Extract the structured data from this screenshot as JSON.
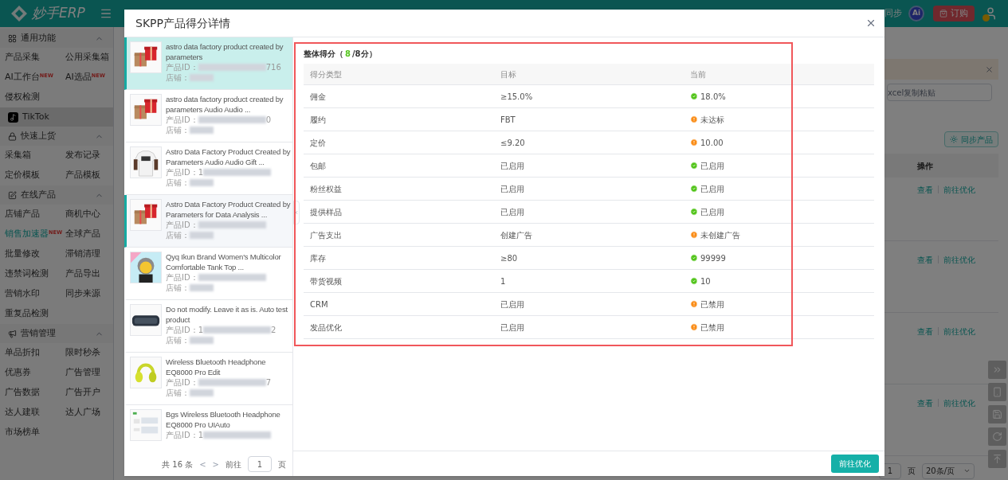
{
  "header": {
    "logo": "妙手ERP",
    "sync": "同步",
    "ai": "Ai",
    "buy": "订购"
  },
  "sidebar": {
    "sections": [
      {
        "kind": "group",
        "title": "通用功能",
        "expanded": true,
        "items": [
          {
            "label": "产品采集",
            "selected": false
          },
          {
            "label": "公用采集箱",
            "selected": false
          },
          {
            "label": "AI工作台",
            "badge": "NEW",
            "selected": false
          },
          {
            "label": "AI选品",
            "badge": "NEW",
            "selected": false
          },
          {
            "label": "侵权检测",
            "selected": false
          }
        ]
      },
      {
        "kind": "platform",
        "title": "TikTok",
        "selected": true
      },
      {
        "kind": "group",
        "title": "快速上货",
        "expanded": true,
        "items": [
          {
            "label": "采集箱",
            "selected": false
          },
          {
            "label": "发布记录",
            "selected": false
          },
          {
            "label": "定价模板",
            "selected": false
          },
          {
            "label": "产品模板",
            "selected": false
          }
        ]
      },
      {
        "kind": "group",
        "title": "在线产品",
        "expanded": true,
        "items": [
          {
            "label": "店铺产品",
            "selected": false
          },
          {
            "label": "商机中心",
            "selected": false
          },
          {
            "label": "销售加速器",
            "badge": "NEW",
            "selected": true
          },
          {
            "label": "全球产品",
            "selected": false
          },
          {
            "label": "批量修改",
            "selected": false
          },
          {
            "label": "滞销清理",
            "selected": false
          },
          {
            "label": "违禁词检测",
            "selected": false
          },
          {
            "label": "产品导出",
            "selected": false
          },
          {
            "label": "营销水印",
            "selected": false
          },
          {
            "label": "同步来源",
            "selected": false
          },
          {
            "label": "重复品检测",
            "selected": false
          }
        ]
      },
      {
        "kind": "group",
        "title": "营销管理",
        "expanded": true,
        "items": [
          {
            "label": "单品折扣",
            "selected": false
          },
          {
            "label": "限时秒杀",
            "selected": false
          },
          {
            "label": "优惠券",
            "selected": false
          },
          {
            "label": "广告管理",
            "selected": false
          },
          {
            "label": "广告数据",
            "selected": false
          },
          {
            "label": "广告开户",
            "selected": false
          },
          {
            "label": "达人建联",
            "selected": false
          },
          {
            "label": "达人广场",
            "selected": false
          },
          {
            "label": "市场榜单",
            "selected": false
          }
        ]
      }
    ]
  },
  "background": {
    "search_text": "xcel复制粘贴",
    "sync_button": "同步产品",
    "action_column": "操作",
    "rows": [
      {
        "view": "查看",
        "optimize": "前往优化"
      },
      {
        "view": "查看",
        "optimize": "前往优化"
      },
      {
        "view": "查看",
        "optimize": "前往优化"
      },
      {
        "view": "查看",
        "optimize": "前往优化"
      }
    ],
    "pagination": {
      "page": "1",
      "unit": "页",
      "size": "20条/页"
    }
  },
  "dialog": {
    "title": "SKPP产品得分详情",
    "products": [
      {
        "title": "astro data factory product created by parameters",
        "id_label": "产品ID：",
        "id_end": "716",
        "shop_label": "店铺：",
        "selected": true,
        "highlighted": false
      },
      {
        "title": "astro data factory product created by parameters Audio Audio ...",
        "id_label": "产品ID：",
        "id_end": "0",
        "shop_label": "店铺：",
        "selected": false,
        "highlighted": false
      },
      {
        "title": "Astro Data Factory Product Created by Parameters Audio Audio Gift ...",
        "id_label": "产品ID：",
        "id_start": "1",
        "shop_label": "店铺：",
        "selected": false,
        "highlighted": false
      },
      {
        "title": "Astro Data Factory Product Created by Parameters for Data Analysis ...",
        "id_label": "产品ID：",
        "shop_label": "店铺：",
        "selected": false,
        "highlighted": true
      },
      {
        "title": "Qyq Ikun Brand Women's Multicolor Comfortable Tank Top ...",
        "id_label": "产品ID：",
        "shop_label": "店铺：",
        "selected": false,
        "highlighted": false
      },
      {
        "title": "Do not modify. Leave it as is. Auto test product",
        "id_label": "产品ID：",
        "id_start": "1",
        "id_end": "2",
        "shop_label": "店铺：",
        "selected": false,
        "highlighted": false
      },
      {
        "title": "Wireless Bluetooth Headphone EQ8000 Pro Edit",
        "id_label": "产品ID：",
        "id_end": "7",
        "shop_label": "店铺：",
        "selected": false,
        "highlighted": false
      },
      {
        "title": "Bgs Wireless Bluetooth Headphone EQ8000 Pro UIAuto",
        "id_label": "产品ID：",
        "id_start": "1",
        "selected": false,
        "highlighted": false
      }
    ],
    "list_pagination": {
      "total": "共 16 条",
      "prev": "<",
      "next": ">",
      "goto": "前往",
      "page": "1",
      "unit": "页"
    },
    "score": {
      "prefix": "整体得分（",
      "value": "8",
      "suffix": "/8分）"
    },
    "columns": [
      "得分类型",
      "目标",
      "当前"
    ],
    "rows": [
      {
        "type": "佣金",
        "target": "≥15.0%",
        "current": "18.0%",
        "met": true
      },
      {
        "type": "履约",
        "target": "FBT",
        "current": "未达标",
        "met": false
      },
      {
        "type": "定价",
        "target": "≤9.20",
        "current": "10.00",
        "met": false
      },
      {
        "type": "包邮",
        "target": "已启用",
        "current": "已启用",
        "met": true
      },
      {
        "type": "粉丝权益",
        "target": "已启用",
        "current": "已启用",
        "met": true
      },
      {
        "type": "提供样品",
        "target": "已启用",
        "current": "已启用",
        "met": true
      },
      {
        "type": "广告支出",
        "target": "创建广告",
        "current": "未创建广告",
        "met": false
      },
      {
        "type": "库存",
        "target": "≥80",
        "current": "99999",
        "met": true
      },
      {
        "type": "带货视频",
        "target": "1",
        "current": "10",
        "met": true
      },
      {
        "type": "CRM",
        "target": "已启用",
        "current": "已禁用",
        "met": false
      },
      {
        "type": "发品优化",
        "target": "已启用",
        "current": "已禁用",
        "met": false
      }
    ],
    "highlight_frame": true,
    "action_button": "前往优化"
  }
}
